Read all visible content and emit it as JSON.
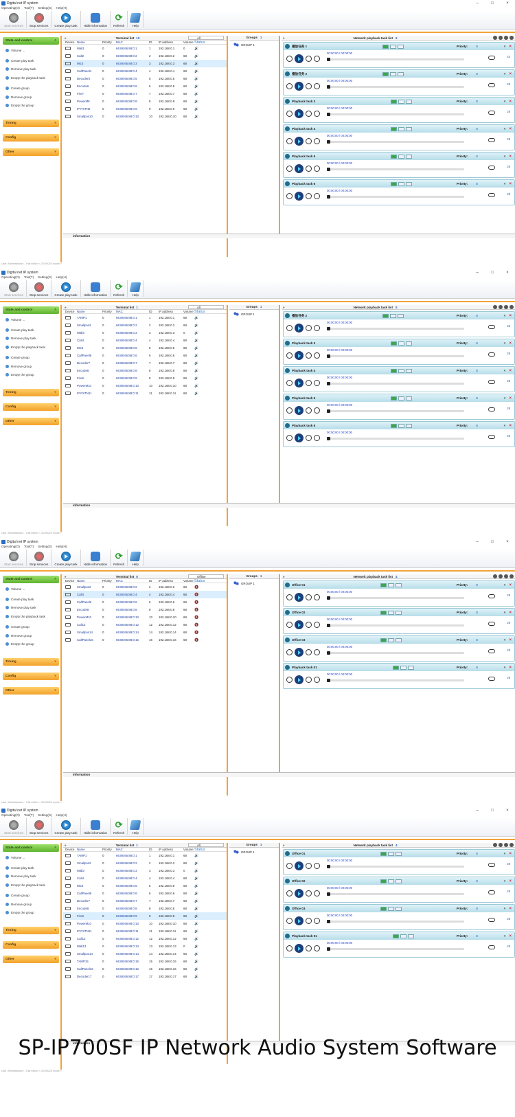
{
  "common": {
    "app_title": "Digital net IP system",
    "menu": [
      "Operating(O)",
      "Tool(T)",
      "Setting(S)",
      "Help(H)"
    ],
    "toolbar": [
      "Start services",
      "Stop services",
      "Create play task",
      "Hidle information",
      "Refresh",
      "Help"
    ],
    "side": {
      "state": "State and control",
      "items": [
        "Volume ...",
        "Create play task",
        "Remove play task",
        "Empty the playback task",
        "Create group",
        "Remove group",
        "Empty the group"
      ],
      "timing": "Timing",
      "config": "Config",
      "other": "Other"
    },
    "terminal_title": "Terminal list",
    "groups_title": "Groups",
    "group1": "GROUP 1",
    "groups_count": "1",
    "playlist_title": "Network playback task list",
    "columns": [
      "Device",
      "Name",
      "Priority",
      "MAC",
      "ID",
      "IP address",
      "Volume",
      "Status"
    ],
    "priority_label": "Priorty:",
    "priority_val": "8",
    "time": "00:00:00 / 00:00:00",
    "info": "information",
    "status": "User: Administrators - Trial edition < 20190224 expire >"
  },
  "shots": [
    {
      "tcount": "10",
      "filter": "All",
      "pcount": "6",
      "rows": [
        [
          "Wall1",
          "0",
          "66:88:66:88:0:1",
          "1",
          "192.168.0.1",
          "0"
        ],
        [
          "Call2",
          "0",
          "66:88:66:88:0:2",
          "2",
          "192.168.0.2",
          "68"
        ],
        [
          "Mic3",
          "0",
          "66:88:66:88:0:3",
          "3",
          "192.168.0.3",
          "68"
        ],
        [
          "CallPanel4",
          "0",
          "66:88:66:88:0:4",
          "4",
          "192.168.0.4",
          "68"
        ],
        [
          "Decoder5",
          "0",
          "66:88:66:88:0:5",
          "5",
          "192.168.0.5",
          "68"
        ],
        [
          "Encode6",
          "0",
          "66:88:66:88:0:6",
          "6",
          "192.168.0.6",
          "68"
        ],
        [
          "Fire7",
          "0",
          "66:88:66:88:0:7",
          "7",
          "192.168.0.7",
          "68"
        ],
        [
          "PowerM8",
          "0",
          "66:88:66:88:0:8",
          "8",
          "192.168.0.8",
          "68"
        ],
        [
          "IP PSTN9",
          "0",
          "66:88:66:88:0:9",
          "9",
          "192.168.0.9",
          "68"
        ],
        [
          "Smallpos10",
          "0",
          "66:88:66:88:0:10",
          "10",
          "192.168.0.10",
          "68"
        ]
      ],
      "tasks": [
        [
          "播放任务 1",
          "43"
        ],
        [
          "播放任务 2",
          "28"
        ],
        [
          "Playback task 3",
          "28"
        ],
        [
          "Playback task 4",
          "28"
        ],
        [
          "Playback task 5",
          "28"
        ],
        [
          "Playback task 6",
          "28"
        ]
      ]
    },
    {
      "tcount": "1",
      "filter": "All",
      "pcount": "5",
      "rows": [
        [
          "TAMP1",
          "0",
          "66:88:66:88:0:1",
          "1",
          "192.168.0.1",
          "68"
        ],
        [
          "Smallpos2",
          "0",
          "66:88:66:88:0:2",
          "2",
          "192.168.0.2",
          "68"
        ],
        [
          "Wall3",
          "0",
          "66:88:66:88:0:3",
          "3",
          "192.168.0.3",
          "0"
        ],
        [
          "Call4",
          "0",
          "66:88:66:88:0:4",
          "4",
          "192.168.0.4",
          "68"
        ],
        [
          "Mic5",
          "0",
          "66:88:66:88:0:5",
          "5",
          "192.168.0.5",
          "68"
        ],
        [
          "CallPanel6",
          "0",
          "66:88:66:88:0:6",
          "6",
          "192.168.0.6",
          "68"
        ],
        [
          "Decoder7",
          "0",
          "66:88:66:88:0:7",
          "7",
          "192.168.0.7",
          "68"
        ],
        [
          "Encode8",
          "0",
          "66:88:66:88:0:8",
          "8",
          "192.168.0.8",
          "68"
        ],
        [
          "Fire9",
          "0",
          "66:88:66:88:0:9",
          "9",
          "192.168.0.9",
          "68"
        ],
        [
          "PowerM10",
          "0",
          "66:88:66:88:0:10",
          "10",
          "192.168.0.10",
          "68"
        ],
        [
          "IP PSTN11",
          "0",
          "66:88:66:88:0:11",
          "11",
          "192.168.0.11",
          "68"
        ]
      ],
      "tasks": [
        [
          "播放任务 2",
          "28"
        ],
        [
          "Playback task 3",
          "28"
        ],
        [
          "Playback task 4",
          "28"
        ],
        [
          "Playback task 5",
          "28"
        ],
        [
          "Playback task 6",
          "28"
        ]
      ]
    },
    {
      "tcount": "8",
      "filter": "Offline",
      "pcount": "4",
      "rows": [
        [
          "Smallpos2",
          "0",
          "66:88:66:88:0:2",
          "2",
          "192.168.0.2",
          "68"
        ],
        [
          "Call4",
          "0",
          "66:88:66:88:0:4",
          "4",
          "192.168.0.4",
          "68"
        ],
        [
          "CallPanel6",
          "0",
          "66:88:66:88:0:6",
          "6",
          "192.168.0.6",
          "68"
        ],
        [
          "Encode8",
          "0",
          "66:88:66:88:0:8",
          "8",
          "192.168.0.8",
          "68"
        ],
        [
          "PowerM10",
          "0",
          "66:88:66:88:0:10",
          "10",
          "192.168.0.10",
          "68"
        ],
        [
          "Call12",
          "0",
          "66:88:66:88:0:12",
          "12",
          "192.168.0.12",
          "68"
        ],
        [
          "Smallpos14",
          "0",
          "66:88:66:88:0:14",
          "14",
          "192.168.0.14",
          "68"
        ],
        [
          "CallPanel16",
          "0",
          "66:88:66:88:0:16",
          "16",
          "192.168.0.16",
          "68"
        ]
      ],
      "tasks": [
        [
          "Office 01",
          "28"
        ],
        [
          "Office 02",
          "28"
        ],
        [
          "Office 03",
          "28"
        ],
        [
          "Playback task 01",
          "28"
        ]
      ]
    },
    {
      "tcount": "1",
      "filter": "All",
      "pcount": "4",
      "rows": [
        [
          "TAMP1",
          "0",
          "66:88:66:88:0:1",
          "1",
          "192.168.0.1",
          "68"
        ],
        [
          "Smallpos2",
          "0",
          "66:88:66:88:0:2",
          "2",
          "192.168.0.2",
          "68"
        ],
        [
          "Wall3",
          "0",
          "66:88:66:88:0:3",
          "3",
          "192.168.0.3",
          "0"
        ],
        [
          "Call4",
          "0",
          "66:88:66:88:0:4",
          "4",
          "192.168.0.4",
          "68"
        ],
        [
          "Mic5",
          "0",
          "66:88:66:88:0:5",
          "5",
          "192.168.0.5",
          "68"
        ],
        [
          "CallPanel6",
          "0",
          "66:88:66:88:0:6",
          "6",
          "192.168.0.6",
          "68"
        ],
        [
          "Decoder7",
          "0",
          "66:88:66:88:0:7",
          "7",
          "192.168.0.7",
          "68"
        ],
        [
          "Encode8",
          "0",
          "66:88:66:88:0:8",
          "8",
          "192.168.0.8",
          "68"
        ],
        [
          "Fire9",
          "0",
          "66:88:66:88:0:9",
          "9",
          "192.168.0.9",
          "68"
        ],
        [
          "PowerM10",
          "0",
          "66:88:66:88:0:10",
          "10",
          "192.168.0.10",
          "68"
        ],
        [
          "IP PSTN11",
          "0",
          "66:88:66:88:0:11",
          "11",
          "192.168.0.11",
          "68"
        ],
        [
          "Call12",
          "0",
          "66:88:66:88:0:12",
          "12",
          "192.168.0.12",
          "68"
        ],
        [
          "Wall13",
          "0",
          "66:88:66:88:0:13",
          "13",
          "192.168.0.13",
          "0"
        ],
        [
          "Smallpos14",
          "0",
          "66:88:66:88:0:14",
          "14",
          "192.168.0.14",
          "68"
        ],
        [
          "TAMP15",
          "0",
          "66:88:66:88:0:15",
          "15",
          "192.168.0.15",
          "68"
        ],
        [
          "CallPanel16",
          "0",
          "66:88:66:88:0:16",
          "16",
          "192.168.0.16",
          "68"
        ],
        [
          "Decoder17",
          "0",
          "66:88:66:88:0:17",
          "17",
          "192.168.0.17",
          "68"
        ]
      ],
      "tasks": [
        [
          "Office 01",
          "28"
        ],
        [
          "Office 02",
          "28"
        ],
        [
          "Office 03",
          "28"
        ],
        [
          "Playback task 01",
          "28"
        ]
      ]
    }
  ],
  "caption": "SP-IP700SF IP Network Audio System Software"
}
